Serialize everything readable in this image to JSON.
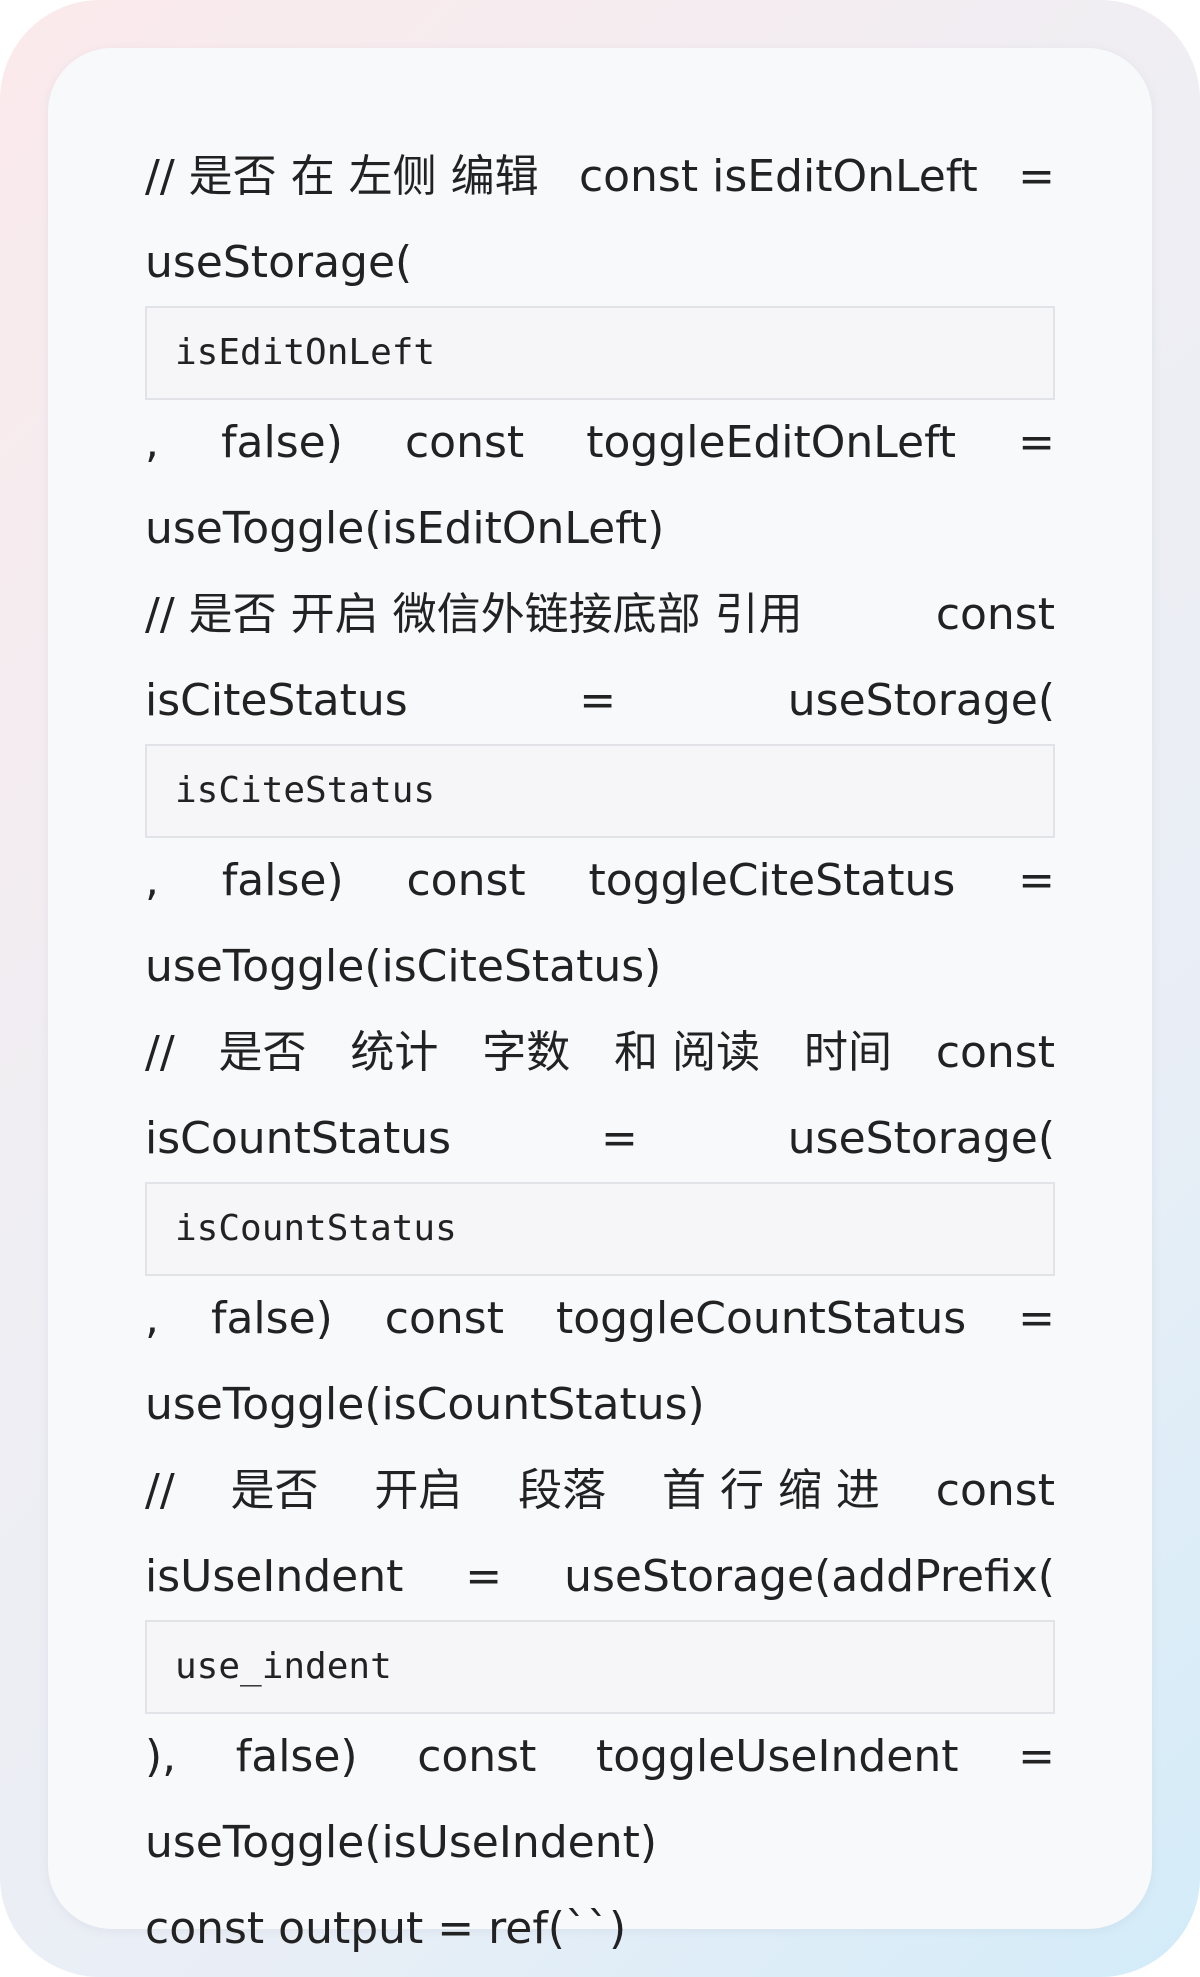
{
  "blocks": [
    {
      "lines": [
        [
          "// 是否 在 左侧 编辑",
          "const isEditOnLeft",
          "="
        ],
        [
          "useStorage("
        ]
      ],
      "code": "isEditOnLeft",
      "after": [
        [
          ",",
          "false)",
          "const",
          "toggleEditOnLeft",
          "="
        ],
        [
          "useToggle(isEditOnLeft)"
        ]
      ]
    },
    {
      "lines": [
        [
          "// 是否 开启 微信外链接底部 引用",
          "const"
        ],
        [
          "isCiteStatus",
          "=",
          "useStorage("
        ]
      ],
      "code": "isCiteStatus",
      "after": [
        [
          ",",
          "false)",
          "const",
          "toggleCiteStatus",
          "="
        ],
        [
          "useToggle(isCiteStatus)"
        ]
      ]
    },
    {
      "lines": [
        [
          "//",
          "是否",
          "统计",
          "字数",
          "和 阅读",
          "时间",
          "const"
        ],
        [
          "isCountStatus",
          "=",
          "useStorage("
        ]
      ],
      "code": "isCountStatus",
      "after": [
        [
          ",",
          "false)",
          "const",
          "toggleCountStatus",
          "="
        ],
        [
          "useToggle(isCountStatus)"
        ]
      ]
    },
    {
      "lines": [
        [
          "//",
          "是否",
          "开启",
          "段落",
          "首 行 缩 进",
          "const"
        ],
        [
          "isUseIndent",
          "=",
          "useStorage(addPrefix("
        ]
      ],
      "code": "use_indent",
      "after": [
        [
          "),",
          "false)",
          "const",
          "toggleUseIndent",
          "="
        ],
        [
          "useToggle(isUseIndent)"
        ]
      ]
    }
  ],
  "final_line": "const output = ref(``)"
}
